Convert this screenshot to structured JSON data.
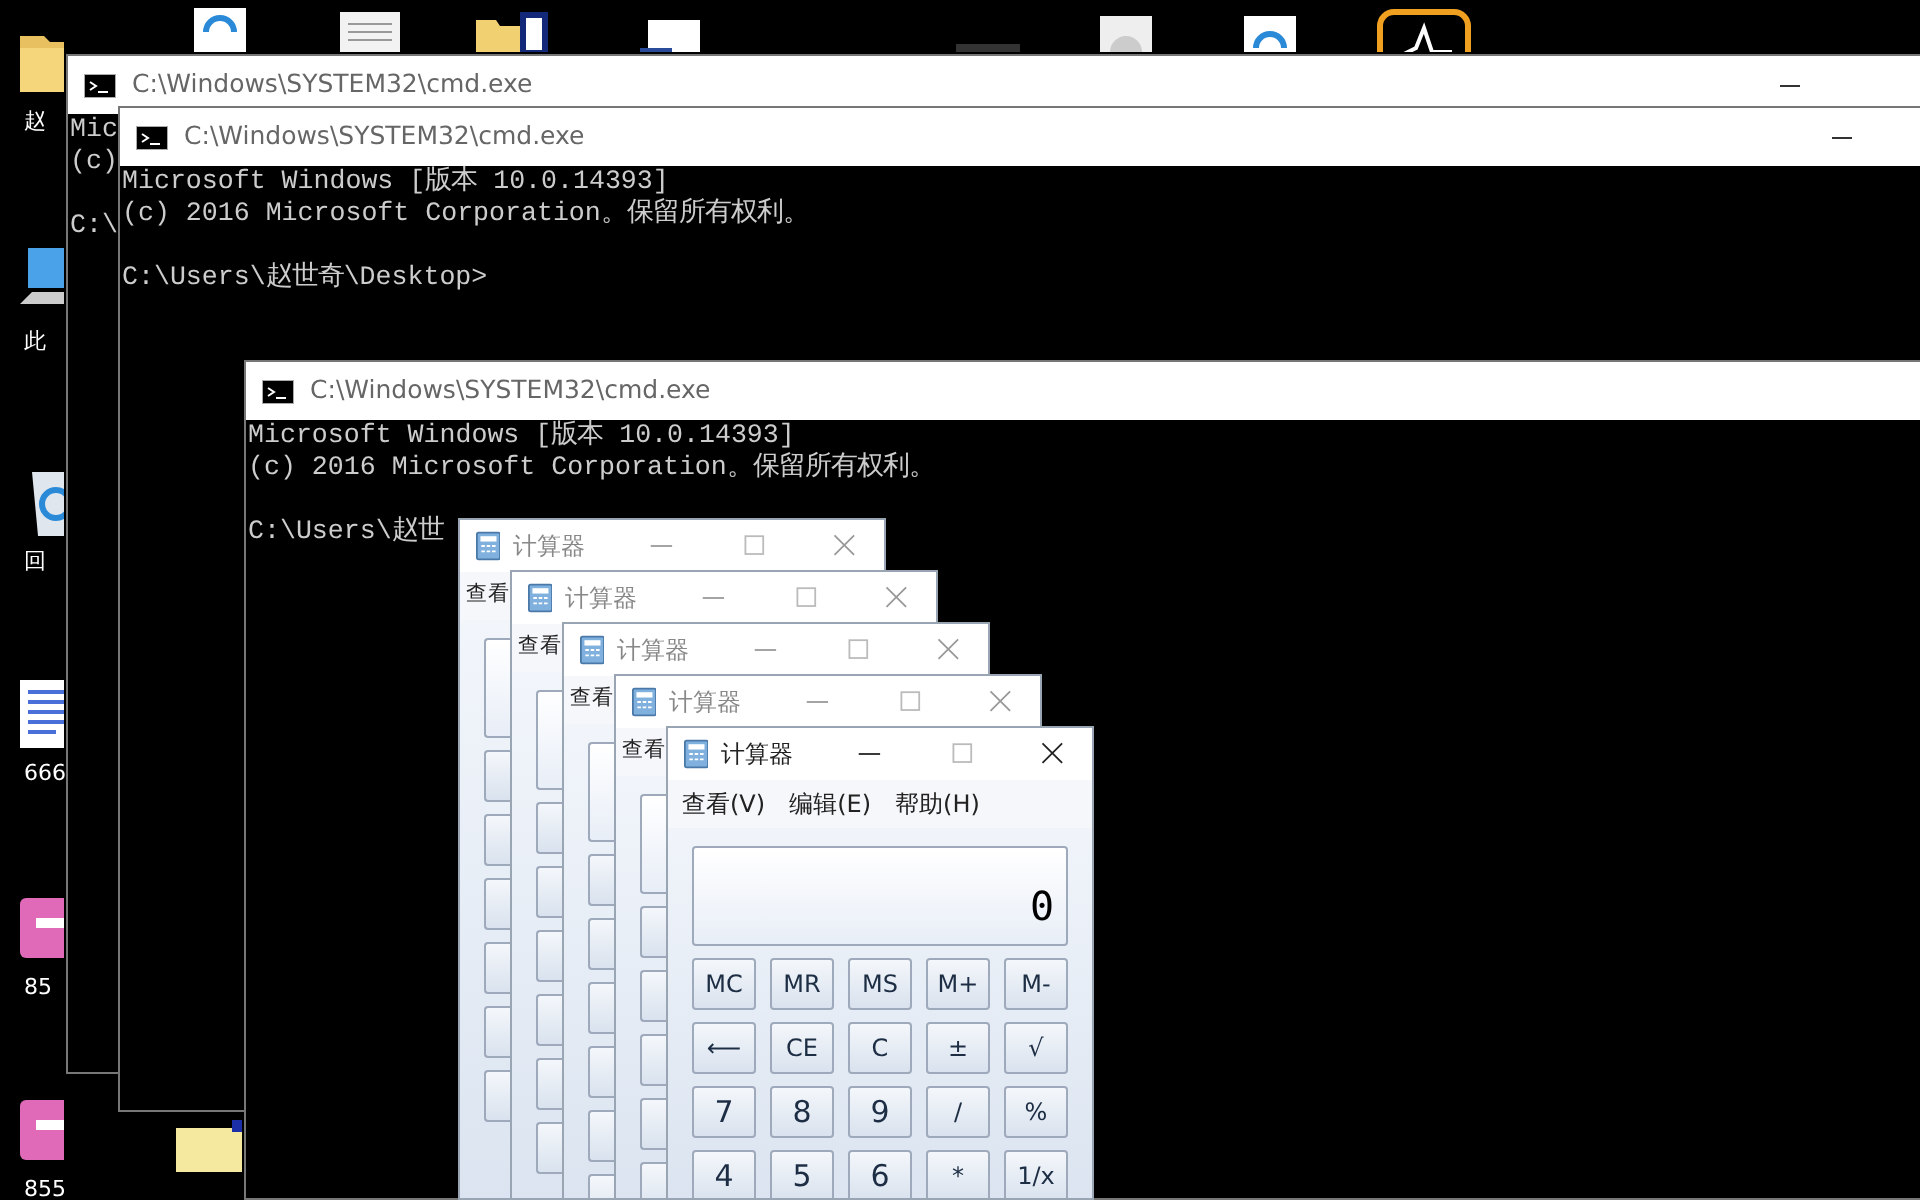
{
  "desktop_icons": [
    {
      "kind": "folder",
      "label": "赵"
    },
    {
      "kind": "computer",
      "label": "此"
    },
    {
      "kind": "recycle",
      "label": "回"
    },
    {
      "kind": "document",
      "label": "666"
    },
    {
      "kind": "image",
      "label": "85"
    },
    {
      "kind": "image",
      "label": "855"
    }
  ],
  "cmd_windows": [
    {
      "title": "C:\\Windows\\SYSTEM32\\cmd.exe",
      "lines": [
        "Mic",
        "(c)",
        "C:\\"
      ]
    },
    {
      "title": "C:\\Windows\\SYSTEM32\\cmd.exe",
      "lines": [
        "Microsoft Windows [版本 10.0.14393]",
        "(c) 2016 Microsoft Corporation。保留所有权利。",
        "C:\\Users\\赵世奇\\Desktop>"
      ]
    },
    {
      "title": "C:\\Windows\\SYSTEM32\\cmd.exe",
      "lines": [
        "Microsoft Windows [版本 10.0.14393]",
        "(c) 2016 Microsoft Corporation。保留所有权利。",
        "C:\\Users\\赵世"
      ]
    }
  ],
  "calculators": [
    {
      "title": "计算器",
      "menu": [
        "查看"
      ]
    },
    {
      "title": "计算器",
      "menu": [
        "查看"
      ]
    },
    {
      "title": "计算器",
      "menu": [
        "查看"
      ]
    },
    {
      "title": "计算器",
      "menu": [
        "查看"
      ]
    },
    {
      "title": "计算器",
      "menu": [
        "查看(V)",
        "编辑(E)",
        "帮助(H)"
      ],
      "display": "0",
      "keys": [
        [
          "MC",
          "MR",
          "MS",
          "M+",
          "M-"
        ],
        [
          "⟵",
          "CE",
          "C",
          "±",
          "√"
        ],
        [
          "7",
          "8",
          "9",
          "/",
          "%"
        ],
        [
          "4",
          "5",
          "6",
          "*",
          "1/x"
        ]
      ]
    }
  ]
}
